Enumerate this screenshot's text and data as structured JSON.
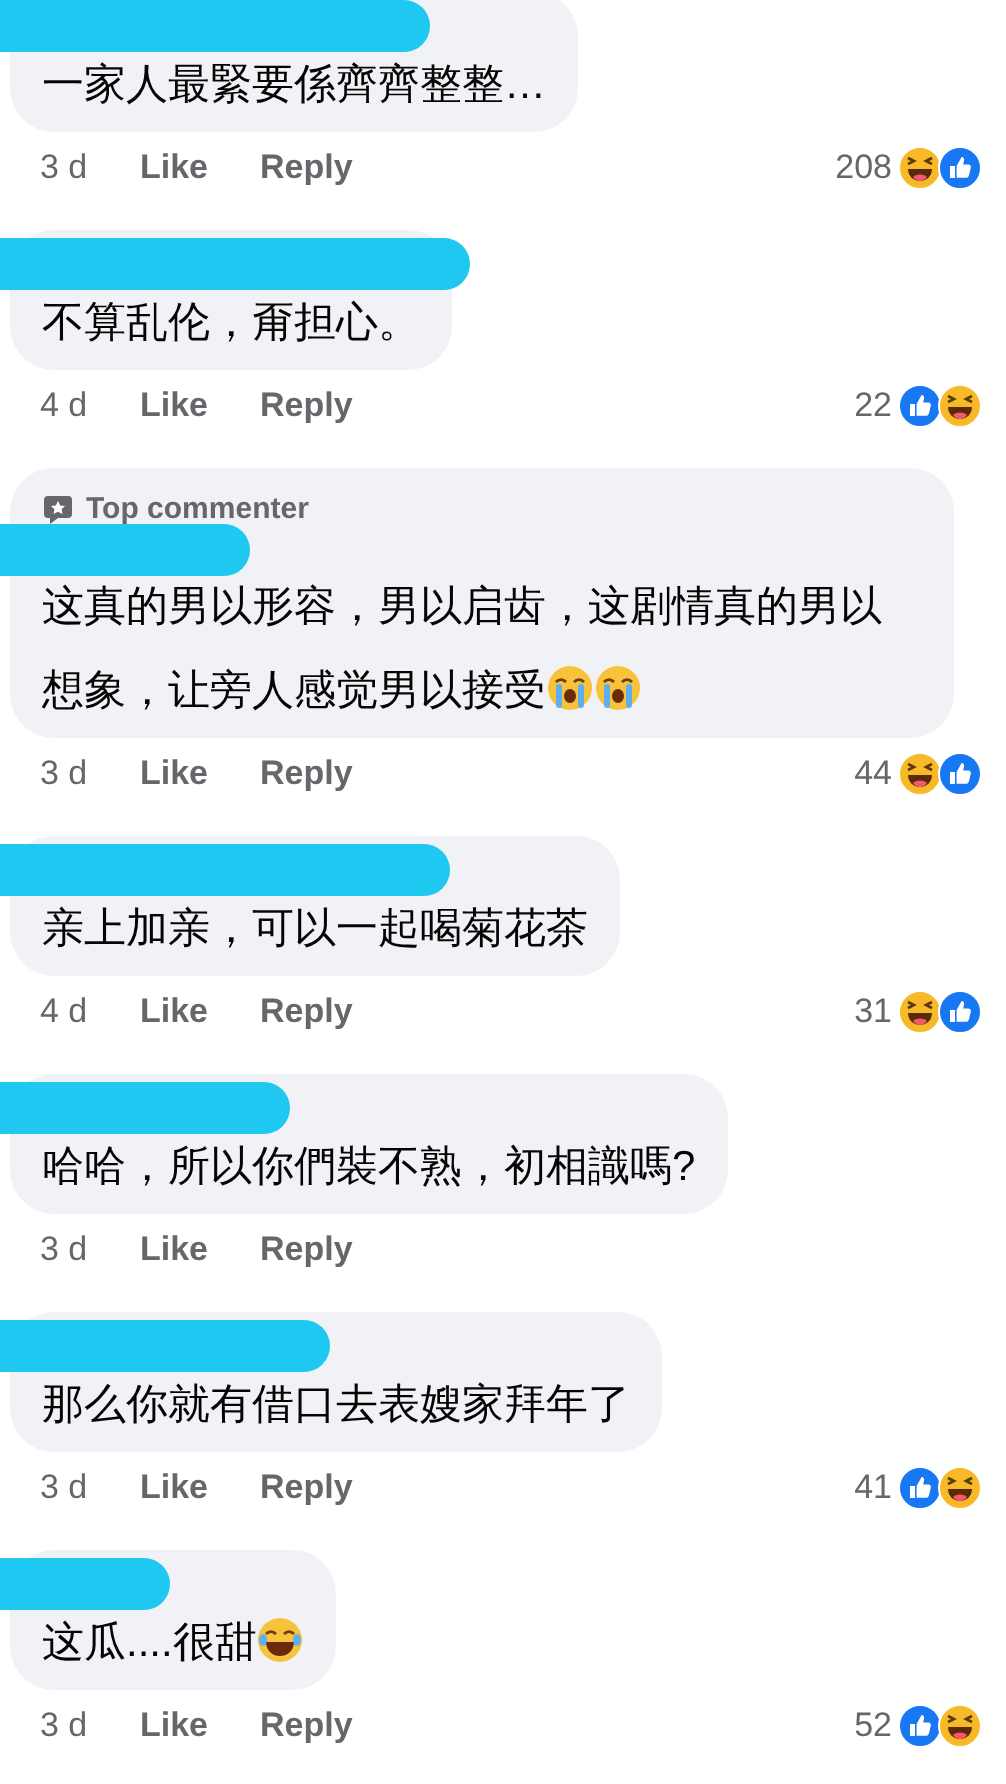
{
  "comments": [
    {
      "text": "一家人最緊要係齊齊整整…",
      "time": "3 d",
      "like": "Like",
      "reply": "Reply",
      "count": "208",
      "reactions": [
        {
          "kind": "haha"
        },
        {
          "kind": "like"
        }
      ]
    },
    {
      "text": "不算乱伦，甭担心。",
      "time": "4 d",
      "like": "Like",
      "reply": "Reply",
      "count": "22",
      "reactions": [
        {
          "kind": "like"
        },
        {
          "kind": "haha"
        }
      ]
    },
    {
      "badge": "Top commenter",
      "text": "这真的男以形容，男以启齿，这剧情真的男以想象，让旁人感觉男以接受",
      "emoji": [
        {
          "kind": "crying"
        },
        {
          "kind": "crying"
        }
      ],
      "time": "3 d",
      "like": "Like",
      "reply": "Reply",
      "count": "44",
      "reactions": [
        {
          "kind": "haha"
        },
        {
          "kind": "like"
        }
      ]
    },
    {
      "text": "亲上加亲，可以一起喝菊花茶",
      "time": "4 d",
      "like": "Like",
      "reply": "Reply",
      "count": "31",
      "reactions": [
        {
          "kind": "haha"
        },
        {
          "kind": "like"
        }
      ]
    },
    {
      "text": "哈哈，所以你們裝不熟，初相識嗎?",
      "time": "3 d",
      "like": "Like",
      "reply": "Reply"
    },
    {
      "text": "那么你就有借口去表嫂家拜年了",
      "time": "3 d",
      "like": "Like",
      "reply": "Reply",
      "count": "41",
      "reactions": [
        {
          "kind": "like"
        },
        {
          "kind": "haha"
        }
      ]
    },
    {
      "text": "这瓜....很甜",
      "emoji": [
        {
          "kind": "tears-of-joy"
        }
      ],
      "time": "3 d",
      "like": "Like",
      "reply": "Reply",
      "count": "52",
      "reactions": [
        {
          "kind": "like"
        },
        {
          "kind": "haha"
        }
      ]
    }
  ]
}
